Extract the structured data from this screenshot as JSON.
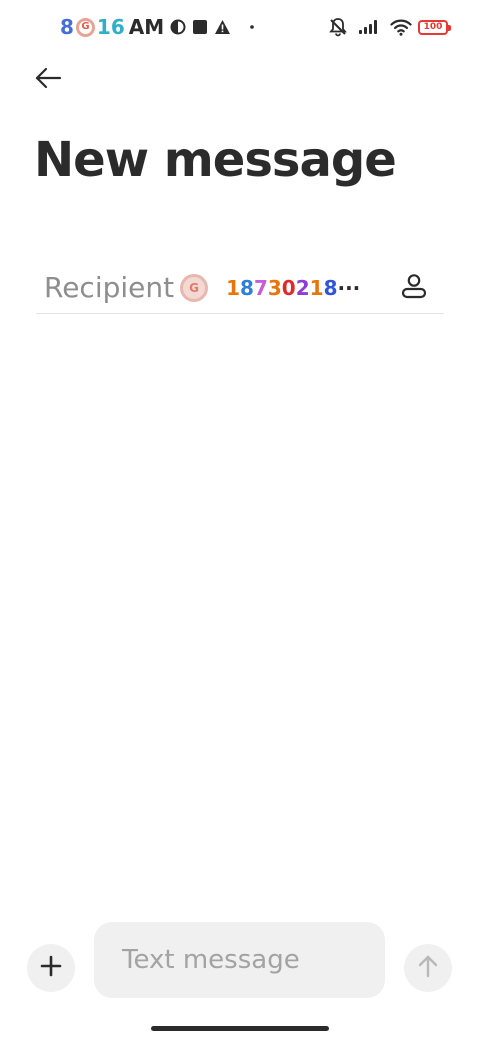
{
  "status_bar": {
    "time_digits": [
      {
        "text": "8",
        "color": "#4a6ed8"
      },
      {
        "text": "16",
        "color": "#2fb0c8"
      }
    ],
    "time_badge": "G",
    "ampm": "AM",
    "battery": "100",
    "colors": {
      "battery": "#e53935",
      "badge": "#e15a4a"
    },
    "icons": [
      "circle-half-icon",
      "square-icon",
      "warning-icon",
      "dot-icon",
      "mute-icon",
      "signal-icon",
      "wifi-icon",
      "battery-icon"
    ]
  },
  "header": {
    "back_icon": "arrow-left-icon",
    "title": "New message"
  },
  "recipient": {
    "label": "Recipient",
    "badge": "G",
    "value_chars": [
      {
        "text": "1",
        "color": "#e8740c"
      },
      {
        "text": "8",
        "color": "#2f7fd9"
      },
      {
        "text": "7",
        "color": "#c95ad8"
      },
      {
        "text": "3",
        "color": "#e8740c"
      },
      {
        "text": "0",
        "color": "#e02a2a"
      },
      {
        "text": "2",
        "color": "#8a3fd9"
      },
      {
        "text": "1",
        "color": "#e8740c"
      },
      {
        "text": "8",
        "color": "#2f56d9"
      },
      {
        "text": "···",
        "color": "#2b2b2b"
      }
    ],
    "contact_icon": "person-icon"
  },
  "composer": {
    "attach_icon": "plus-icon",
    "placeholder": "Text message",
    "send_icon": "arrow-up-icon"
  }
}
